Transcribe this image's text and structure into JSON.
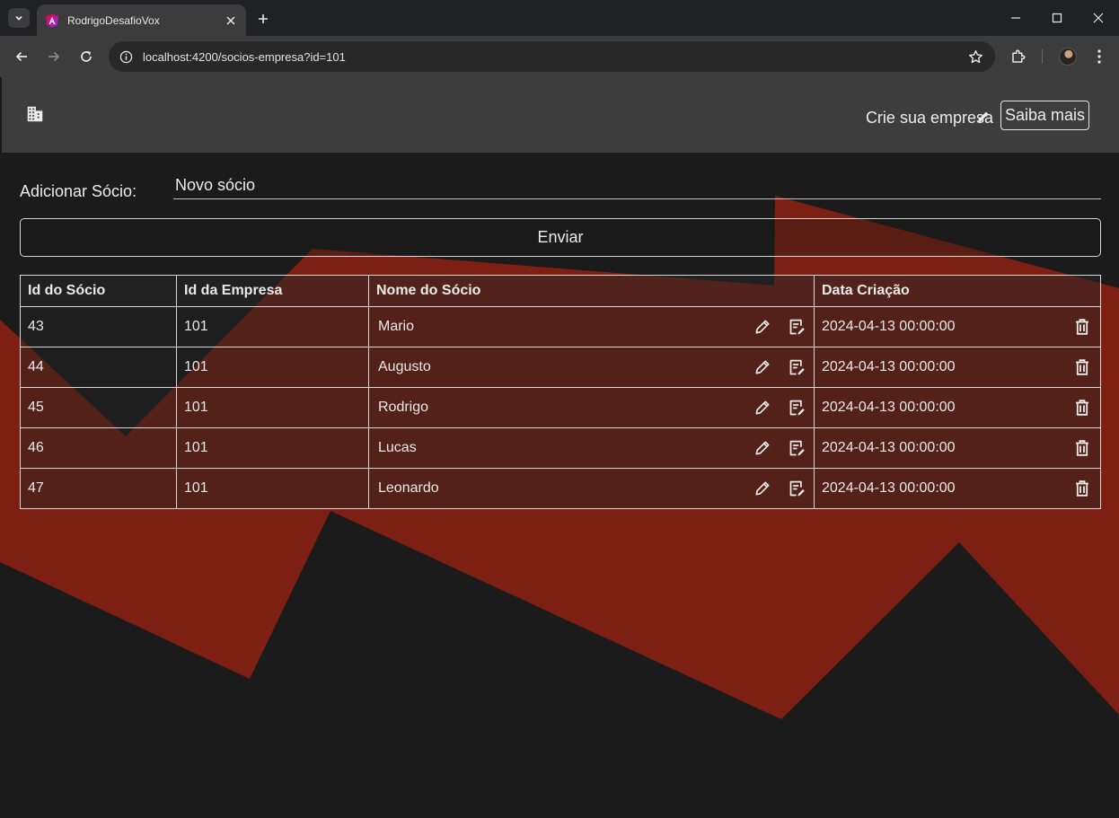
{
  "browser": {
    "tab_title": "RodrigoDesafioVox",
    "url_host": "localhost",
    "url_rest": ":4200/socios-empresa?id=101"
  },
  "header": {
    "create_label": "Crie sua empresa",
    "learn_more_label": "Saiba mais"
  },
  "form": {
    "label": "Adicionar Sócio:",
    "input_placeholder": "Novo sócio",
    "submit_label": "Enviar"
  },
  "table": {
    "columns": [
      "Id do Sócio",
      "Id da Empresa",
      "Nome do Sócio",
      "Data Criação"
    ],
    "rows": [
      {
        "id": "43",
        "company_id": "101",
        "name": "Mario",
        "created": "2024-04-13 00:00:00"
      },
      {
        "id": "44",
        "company_id": "101",
        "name": "Augusto",
        "created": "2024-04-13 00:00:00"
      },
      {
        "id": "45",
        "company_id": "101",
        "name": "Rodrigo",
        "created": "2024-04-13 00:00:00"
      },
      {
        "id": "46",
        "company_id": "101",
        "name": "Lucas",
        "created": "2024-04-13 00:00:00"
      },
      {
        "id": "47",
        "company_id": "101",
        "name": "Leonardo",
        "created": "2024-04-13 00:00:00"
      }
    ]
  },
  "colors": {
    "accent_red": "#7d1f12",
    "page_bg": "#1b1b1b",
    "header_bg": "#3d3d3d"
  },
  "icons": {
    "logo": "business-building-icon",
    "create": "pencil-icon",
    "row_edit": "pencil-icon",
    "row_save": "edit-document-icon",
    "row_delete": "trash-icon"
  }
}
